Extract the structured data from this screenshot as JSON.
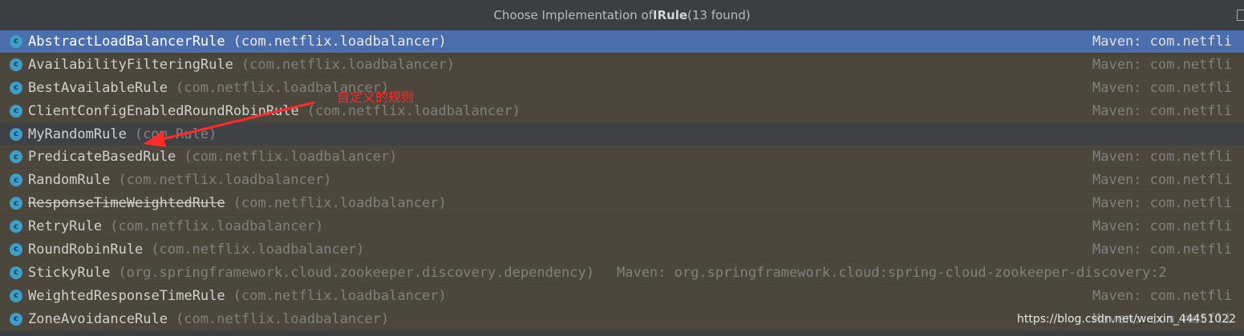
{
  "title": {
    "prefix": "Choose Implementation of ",
    "type_name": "IRule",
    "suffix": " (13 found)"
  },
  "colors": {
    "selected_row": "#4b6eaf",
    "class_icon": "#3d9ec7",
    "annotation": "#ff2a2a"
  },
  "rows": [
    {
      "name": "AbstractLoadBalancerRule",
      "pkg": "(com.netflix.loadbalancer)",
      "maven": "Maven: com.netfli"
    },
    {
      "name": "AvailabilityFilteringRule",
      "pkg": "(com.netflix.loadbalancer)",
      "maven": "Maven: com.netfli"
    },
    {
      "name": "BestAvailableRule",
      "pkg": "(com.netflix.loadbalancer)",
      "maven": "Maven: com.netfli"
    },
    {
      "name": "ClientConfigEnabledRoundRobinRule",
      "pkg": "(com.netflix.loadbalancer)",
      "maven": "Maven: com.netfli"
    },
    {
      "name": "MyRandomRule",
      "pkg": "(com.Rule)",
      "maven": ""
    },
    {
      "name": "PredicateBasedRule",
      "pkg": "(com.netflix.loadbalancer)",
      "maven": "Maven: com.netfli"
    },
    {
      "name": "RandomRule",
      "pkg": "(com.netflix.loadbalancer)",
      "maven": "Maven: com.netfli"
    },
    {
      "name": "ResponseTimeWeightedRule",
      "pkg": "(com.netflix.loadbalancer)",
      "maven": "Maven: com.netfli"
    },
    {
      "name": "RetryRule",
      "pkg": "(com.netflix.loadbalancer)",
      "maven": "Maven: com.netfli"
    },
    {
      "name": "RoundRobinRule",
      "pkg": "(com.netflix.loadbalancer)",
      "maven": "Maven: com.netfli"
    },
    {
      "name": "StickyRule",
      "pkg": "(org.springframework.cloud.zookeeper.discovery.dependency)",
      "maven": "Maven: org.springframework.cloud:spring-cloud-zookeeper-discovery:2"
    },
    {
      "name": "WeightedResponseTimeRule",
      "pkg": "(com.netflix.loadbalancer)",
      "maven": "Maven: com.netfli"
    },
    {
      "name": "ZoneAvoidanceRule",
      "pkg": "(com.netflix.loadbalancer)",
      "maven": "Maven: com.netfli"
    }
  ],
  "class_icon_letter": "c",
  "annotation": {
    "text": "自定义的规则"
  },
  "watermark": "https://blog.csdn.net/weixin_44451022"
}
